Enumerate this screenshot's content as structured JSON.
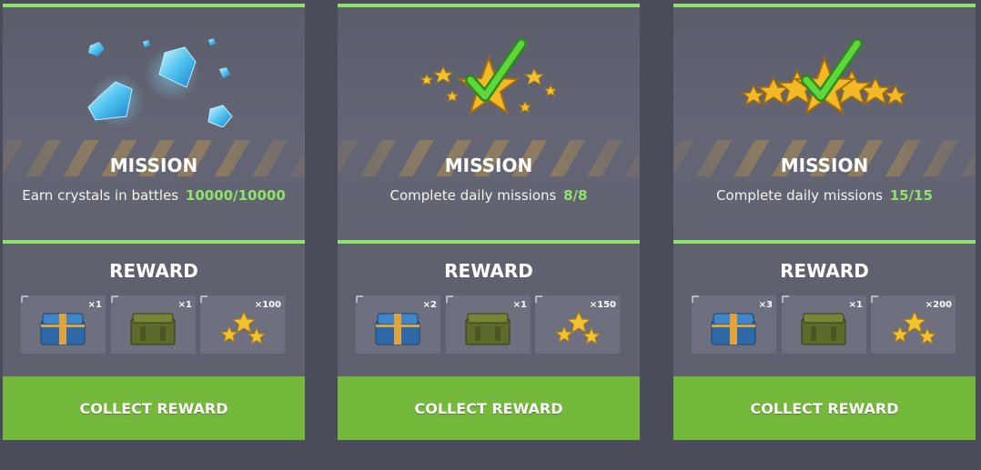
{
  "missions": [
    {
      "mission_label": "MISSION",
      "description": "Earn crystals in battles",
      "progress": "10000/10000",
      "art_icon": "crystals-icon",
      "reward_label": "REWARD",
      "rewards": [
        {
          "icon": "blue-container-icon",
          "qty": "×1"
        },
        {
          "icon": "green-container-icon",
          "qty": "×1"
        },
        {
          "icon": "stars-icon",
          "qty": "×100"
        }
      ],
      "button_label": "COLLECT REWARD"
    },
    {
      "mission_label": "MISSION",
      "description": "Complete daily missions",
      "progress": "8/8",
      "art_icon": "star-checkmark-icon",
      "reward_label": "REWARD",
      "rewards": [
        {
          "icon": "blue-container-icon",
          "qty": "×2"
        },
        {
          "icon": "green-container-icon",
          "qty": "×1"
        },
        {
          "icon": "stars-icon",
          "qty": "×150"
        }
      ],
      "button_label": "COLLECT REWARD"
    },
    {
      "mission_label": "MISSION",
      "description": "Complete daily missions",
      "progress": "15/15",
      "art_icon": "star-row-checkmark-icon",
      "reward_label": "REWARD",
      "rewards": [
        {
          "icon": "blue-container-icon",
          "qty": "×3"
        },
        {
          "icon": "green-container-icon",
          "qty": "×1"
        },
        {
          "icon": "stars-icon",
          "qty": "×200"
        }
      ],
      "button_label": "COLLECT REWARD"
    }
  ],
  "colors": {
    "accent_green": "#8fe36a",
    "button_green": "#74b93b",
    "card_bg": "#5f616f",
    "page_bg": "#4a4c5a"
  }
}
